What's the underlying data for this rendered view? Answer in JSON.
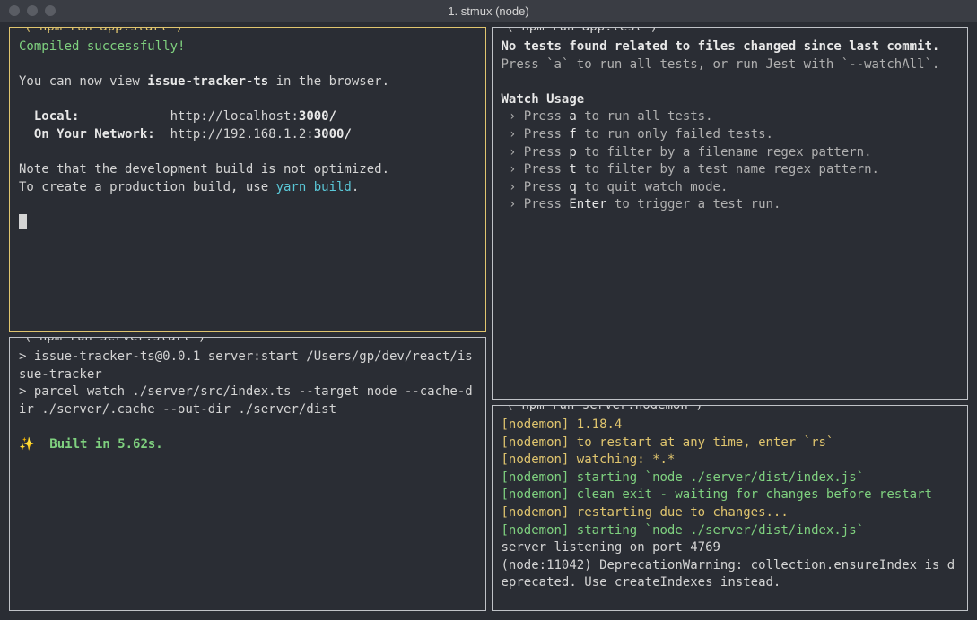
{
  "window": {
    "title": "1. stmux (node)"
  },
  "panes": {
    "appStart": {
      "label": "( npm run app:start )",
      "line1": "Compiled successfully!",
      "line2a": "You can now view ",
      "line2b": "issue-tracker-ts",
      "line2c": " in the browser.",
      "localLabel": "  Local:",
      "localPad": "            ",
      "localUrlA": "http://localhost:",
      "localUrlB": "3000/",
      "netLabel": "  On Your Network:",
      "netPad": "  ",
      "netUrlA": "http://192.168.1.2:",
      "netUrlB": "3000/",
      "note1": "Note that the development build is not optimized.",
      "note2a": "To create a production build, use ",
      "note2b": "yarn build",
      "note2c": "."
    },
    "serverStart": {
      "label": "( npm run server:start )",
      "line1": "> issue-tracker-ts@0.0.1 server:start /Users/gp/dev/react/issue-tracker",
      "line2": "> parcel watch ./server/src/index.ts --target node --cache-dir ./server/.cache --out-dir ./server/dist",
      "sparkle": "✨  ",
      "built": "Built in 5.62s."
    },
    "appTest": {
      "label": "( npm run app:test )",
      "line1": "No tests found related to files changed since last commit.",
      "line2": "Press `a` to run all tests, or run Jest with `--watchAll`.",
      "heading": "Watch Usage",
      "u1a": " › Press ",
      "u1b": "a",
      "u1c": " to run all tests.",
      "u2a": " › Press ",
      "u2b": "f",
      "u2c": " to run only failed tests.",
      "u3a": " › Press ",
      "u3b": "p",
      "u3c": " to filter by a filename regex pattern.",
      "u4a": " › Press ",
      "u4b": "t",
      "u4c": " to filter by a test name regex pattern.",
      "u5a": " › Press ",
      "u5b": "q",
      "u5c": " to quit watch mode.",
      "u6a": " › Press ",
      "u6b": "Enter",
      "u6c": " to trigger a test run."
    },
    "serverNodemon": {
      "label": "( npm run server:nodemon )",
      "l1": "[nodemon] 1.18.4",
      "l2": "[nodemon] to restart at any time, enter `rs`",
      "l3": "[nodemon] watching: *.*",
      "l4": "[nodemon] starting `node ./server/dist/index.js`",
      "l5": "[nodemon] clean exit - waiting for changes before restart",
      "l6": "[nodemon] restarting due to changes...",
      "l7": "[nodemon] starting `node ./server/dist/index.js`",
      "l8": "server listening on port 4769",
      "l9": "(node:11042) DeprecationWarning: collection.ensureIndex is deprecated. Use createIndexes instead."
    }
  }
}
